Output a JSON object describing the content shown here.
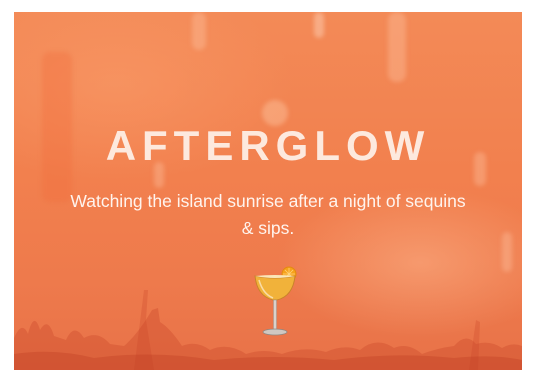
{
  "card": {
    "title": "AFTERGLOW",
    "subtitle": "Watching the island sunrise after a night of sequins & sips.",
    "icon": "cocktail-glass-icon"
  },
  "colors": {
    "background": "#f2804e",
    "title": "#fde9de",
    "subtitle": "#fff4ee"
  }
}
